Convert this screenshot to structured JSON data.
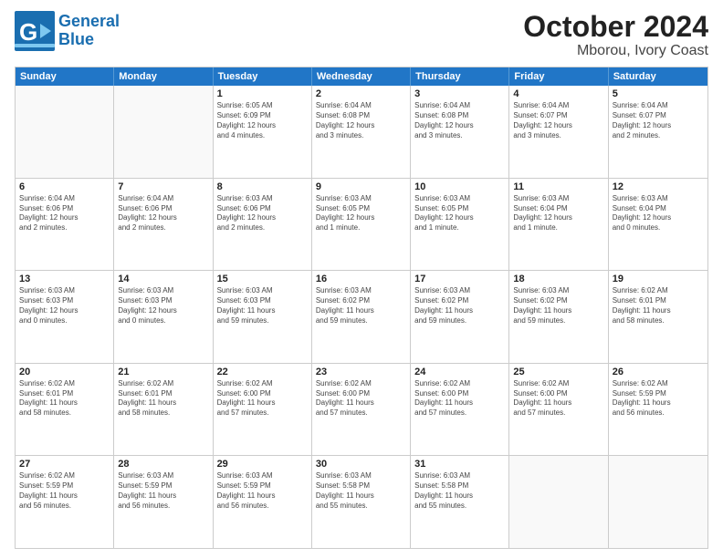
{
  "logo": {
    "line1": "General",
    "line2": "Blue"
  },
  "title": "October 2024",
  "subtitle": "Mborou, Ivory Coast",
  "weekdays": [
    "Sunday",
    "Monday",
    "Tuesday",
    "Wednesday",
    "Thursday",
    "Friday",
    "Saturday"
  ],
  "rows": [
    [
      {
        "day": "",
        "detail": "",
        "empty": true
      },
      {
        "day": "",
        "detail": "",
        "empty": true
      },
      {
        "day": "1",
        "detail": "Sunrise: 6:05 AM\nSunset: 6:09 PM\nDaylight: 12 hours\nand 4 minutes."
      },
      {
        "day": "2",
        "detail": "Sunrise: 6:04 AM\nSunset: 6:08 PM\nDaylight: 12 hours\nand 3 minutes."
      },
      {
        "day": "3",
        "detail": "Sunrise: 6:04 AM\nSunset: 6:08 PM\nDaylight: 12 hours\nand 3 minutes."
      },
      {
        "day": "4",
        "detail": "Sunrise: 6:04 AM\nSunset: 6:07 PM\nDaylight: 12 hours\nand 3 minutes."
      },
      {
        "day": "5",
        "detail": "Sunrise: 6:04 AM\nSunset: 6:07 PM\nDaylight: 12 hours\nand 2 minutes."
      }
    ],
    [
      {
        "day": "6",
        "detail": "Sunrise: 6:04 AM\nSunset: 6:06 PM\nDaylight: 12 hours\nand 2 minutes."
      },
      {
        "day": "7",
        "detail": "Sunrise: 6:04 AM\nSunset: 6:06 PM\nDaylight: 12 hours\nand 2 minutes."
      },
      {
        "day": "8",
        "detail": "Sunrise: 6:03 AM\nSunset: 6:06 PM\nDaylight: 12 hours\nand 2 minutes."
      },
      {
        "day": "9",
        "detail": "Sunrise: 6:03 AM\nSunset: 6:05 PM\nDaylight: 12 hours\nand 1 minute."
      },
      {
        "day": "10",
        "detail": "Sunrise: 6:03 AM\nSunset: 6:05 PM\nDaylight: 12 hours\nand 1 minute."
      },
      {
        "day": "11",
        "detail": "Sunrise: 6:03 AM\nSunset: 6:04 PM\nDaylight: 12 hours\nand 1 minute."
      },
      {
        "day": "12",
        "detail": "Sunrise: 6:03 AM\nSunset: 6:04 PM\nDaylight: 12 hours\nand 0 minutes."
      }
    ],
    [
      {
        "day": "13",
        "detail": "Sunrise: 6:03 AM\nSunset: 6:03 PM\nDaylight: 12 hours\nand 0 minutes."
      },
      {
        "day": "14",
        "detail": "Sunrise: 6:03 AM\nSunset: 6:03 PM\nDaylight: 12 hours\nand 0 minutes."
      },
      {
        "day": "15",
        "detail": "Sunrise: 6:03 AM\nSunset: 6:03 PM\nDaylight: 11 hours\nand 59 minutes."
      },
      {
        "day": "16",
        "detail": "Sunrise: 6:03 AM\nSunset: 6:02 PM\nDaylight: 11 hours\nand 59 minutes."
      },
      {
        "day": "17",
        "detail": "Sunrise: 6:03 AM\nSunset: 6:02 PM\nDaylight: 11 hours\nand 59 minutes."
      },
      {
        "day": "18",
        "detail": "Sunrise: 6:03 AM\nSunset: 6:02 PM\nDaylight: 11 hours\nand 59 minutes."
      },
      {
        "day": "19",
        "detail": "Sunrise: 6:02 AM\nSunset: 6:01 PM\nDaylight: 11 hours\nand 58 minutes."
      }
    ],
    [
      {
        "day": "20",
        "detail": "Sunrise: 6:02 AM\nSunset: 6:01 PM\nDaylight: 11 hours\nand 58 minutes."
      },
      {
        "day": "21",
        "detail": "Sunrise: 6:02 AM\nSunset: 6:01 PM\nDaylight: 11 hours\nand 58 minutes."
      },
      {
        "day": "22",
        "detail": "Sunrise: 6:02 AM\nSunset: 6:00 PM\nDaylight: 11 hours\nand 57 minutes."
      },
      {
        "day": "23",
        "detail": "Sunrise: 6:02 AM\nSunset: 6:00 PM\nDaylight: 11 hours\nand 57 minutes."
      },
      {
        "day": "24",
        "detail": "Sunrise: 6:02 AM\nSunset: 6:00 PM\nDaylight: 11 hours\nand 57 minutes."
      },
      {
        "day": "25",
        "detail": "Sunrise: 6:02 AM\nSunset: 6:00 PM\nDaylight: 11 hours\nand 57 minutes."
      },
      {
        "day": "26",
        "detail": "Sunrise: 6:02 AM\nSunset: 5:59 PM\nDaylight: 11 hours\nand 56 minutes."
      }
    ],
    [
      {
        "day": "27",
        "detail": "Sunrise: 6:02 AM\nSunset: 5:59 PM\nDaylight: 11 hours\nand 56 minutes."
      },
      {
        "day": "28",
        "detail": "Sunrise: 6:03 AM\nSunset: 5:59 PM\nDaylight: 11 hours\nand 56 minutes."
      },
      {
        "day": "29",
        "detail": "Sunrise: 6:03 AM\nSunset: 5:59 PM\nDaylight: 11 hours\nand 56 minutes."
      },
      {
        "day": "30",
        "detail": "Sunrise: 6:03 AM\nSunset: 5:58 PM\nDaylight: 11 hours\nand 55 minutes."
      },
      {
        "day": "31",
        "detail": "Sunrise: 6:03 AM\nSunset: 5:58 PM\nDaylight: 11 hours\nand 55 minutes."
      },
      {
        "day": "",
        "detail": "",
        "empty": true
      },
      {
        "day": "",
        "detail": "",
        "empty": true
      }
    ]
  ]
}
